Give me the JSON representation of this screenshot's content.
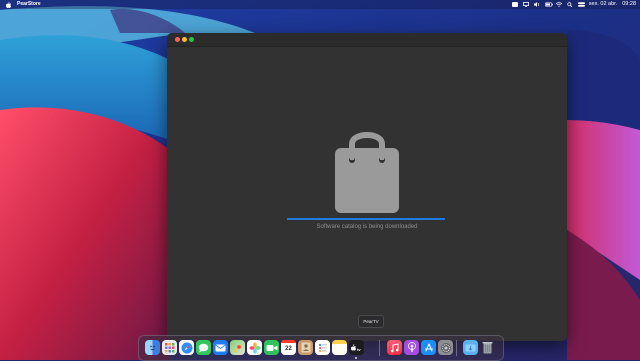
{
  "menubar": {
    "app_name": "PearStore",
    "date": "sex. 02 abr.",
    "time": "09:28",
    "icons": [
      "apple-icon",
      "menu-app-icon",
      "screen-mirror-icon",
      "volume-icon",
      "battery-icon",
      "wifi-icon",
      "search-icon",
      "control-center-icon"
    ]
  },
  "window": {
    "status_text": "Software catalog is being downloaded",
    "progress": 1.0,
    "accent": "#1f7cde"
  },
  "tooltip": {
    "text": "PearTV"
  },
  "dock": {
    "calendar_day": "22",
    "items": [
      "finder",
      "launchpad",
      "safari",
      "messages",
      "mail",
      "maps",
      "photos",
      "facetime",
      "calendar",
      "contacts",
      "reminders",
      "notes",
      "peartv",
      "music",
      "podcasts",
      "app-store",
      "system-preferences",
      "downloads",
      "trash"
    ]
  }
}
